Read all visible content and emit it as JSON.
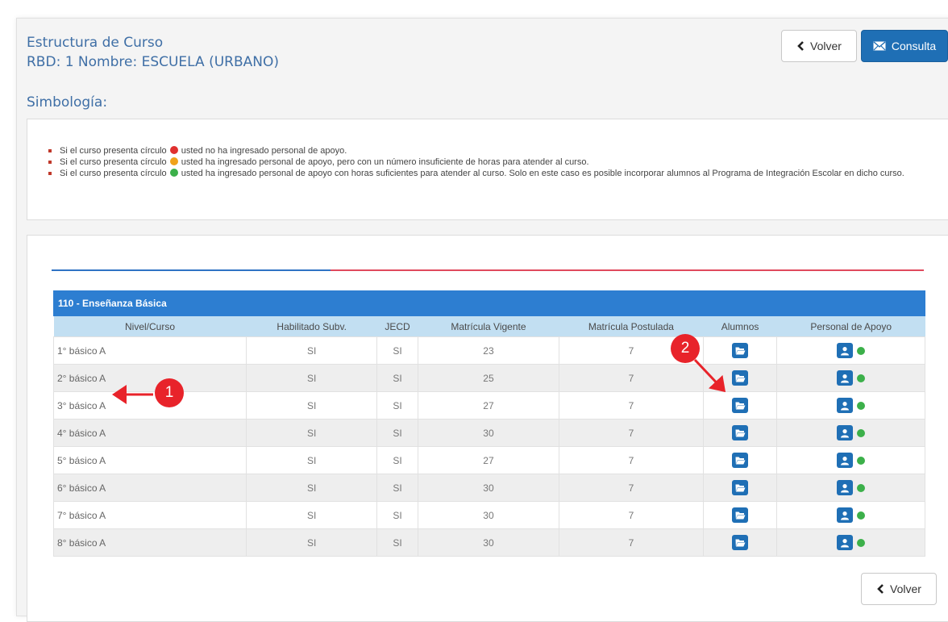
{
  "header": {
    "title": "Estructura de Curso",
    "subtitle": "RBD: 1 Nombre: ESCUELA   (URBANO)",
    "volver_label": "Volver",
    "consulta_label": "Consulta"
  },
  "simbologia": {
    "heading": "Simbología:",
    "items": [
      {
        "before": "Si el curso presenta círculo",
        "color": "#e0302f",
        "after": "usted no ha ingresado personal de apoyo."
      },
      {
        "before": "Si el curso presenta círculo",
        "color": "#f0a21b",
        "after": "usted ha ingresado personal de apoyo, pero con un número insuficiente de horas para atender al curso."
      },
      {
        "before": "Si el curso presenta círculo",
        "color": "#3cb04a",
        "after": "usted ha ingresado personal de apoyo con horas suficientes para atender al curso. Solo en este caso es posible incorporar alumnos al Programa de Integración Escolar en dicho curso."
      }
    ]
  },
  "table": {
    "title": "110 - Enseñanza Básica",
    "headers": [
      "Nivel/Curso",
      "Habilitado Subv.",
      "JECD",
      "Matrícula Vigente",
      "Matrícula Postulada",
      "Alumnos",
      "Personal de Apoyo"
    ],
    "rows": [
      {
        "curso": "1° básico A",
        "habilitado": "SI",
        "jecd": "SI",
        "vigente": "23",
        "postulada": "7"
      },
      {
        "curso": "2° básico A",
        "habilitado": "SI",
        "jecd": "SI",
        "vigente": "25",
        "postulada": "7"
      },
      {
        "curso": "3° básico A",
        "habilitado": "SI",
        "jecd": "SI",
        "vigente": "27",
        "postulada": "7"
      },
      {
        "curso": "4° básico A",
        "habilitado": "SI",
        "jecd": "SI",
        "vigente": "30",
        "postulada": "7"
      },
      {
        "curso": "5° básico A",
        "habilitado": "SI",
        "jecd": "SI",
        "vigente": "27",
        "postulada": "7"
      },
      {
        "curso": "6° básico A",
        "habilitado": "SI",
        "jecd": "SI",
        "vigente": "30",
        "postulada": "7"
      },
      {
        "curso": "7° básico A",
        "habilitado": "SI",
        "jecd": "SI",
        "vigente": "30",
        "postulada": "7"
      },
      {
        "curso": "8° básico A",
        "habilitado": "SI",
        "jecd": "SI",
        "vigente": "30",
        "postulada": "7"
      }
    ],
    "status_color": "#3cb04a",
    "alumnos_icon": "folder-open-icon",
    "personal_icon": "user-icon"
  },
  "footer": {
    "volver_label": "Volver"
  },
  "annotations": [
    {
      "label": "1",
      "color": "#e8232a"
    },
    {
      "label": "2",
      "color": "#e8232a"
    }
  ],
  "colors": {
    "accent": "#1f6fb5",
    "table_title_bg": "#2d7ed1",
    "header_bg": "#c2dff2",
    "rule_blue": "#2f73c4",
    "rule_red": "#e0495d"
  }
}
